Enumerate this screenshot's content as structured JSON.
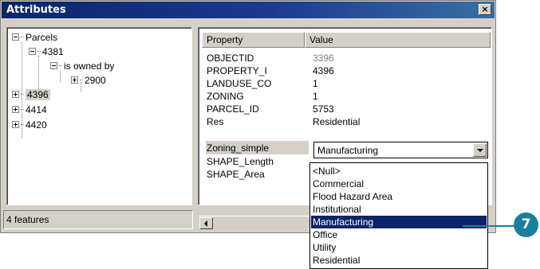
{
  "window": {
    "title": "Attributes",
    "close_label": "×"
  },
  "tree": {
    "root": "Parcels",
    "nodes": [
      {
        "label": "4381"
      },
      {
        "label": "is owned by"
      },
      {
        "label": "2900"
      },
      {
        "label": "4396"
      },
      {
        "label": "4414"
      },
      {
        "label": "4420"
      }
    ]
  },
  "status": {
    "features": "4 features"
  },
  "grid": {
    "columns": [
      "Property",
      "Value"
    ],
    "rows": [
      {
        "property": "OBJECTID",
        "value": "3396"
      },
      {
        "property": "PROPERTY_I",
        "value": "4396"
      },
      {
        "property": "LANDUSE_CO",
        "value": "1"
      },
      {
        "property": "ZONING",
        "value": "1"
      },
      {
        "property": "PARCEL_ID",
        "value": "5753"
      },
      {
        "property": "Res",
        "value": "Residential"
      },
      {
        "property": "Zoning_simple",
        "value": ""
      },
      {
        "property": "SHAPE_Length",
        "value": ""
      },
      {
        "property": "SHAPE_Area",
        "value": ""
      }
    ]
  },
  "combo": {
    "selected": "Manufacturing",
    "options": [
      "<Null>",
      "Commercial",
      "Flood Hazard Area",
      "Institutional",
      "Manufacturing",
      "Office",
      "Utility",
      "Residential"
    ]
  },
  "callout": {
    "label": "7",
    "color": "#1a7f9c"
  },
  "colors": {
    "titlebar": "#0a246a",
    "selection": "#0a246a",
    "face": "#d4d0c8"
  }
}
